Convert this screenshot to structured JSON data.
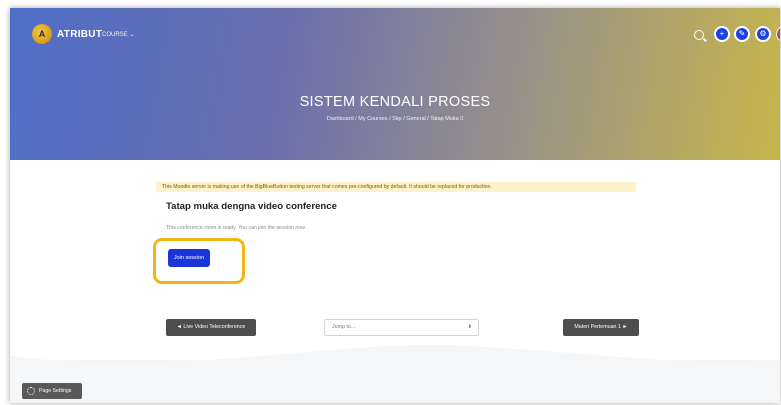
{
  "navbar": {
    "logo_text": "A",
    "brand": "ATRIBUT",
    "course_menu": "COURSE ⌄",
    "icons": [
      "search-icon",
      "add-icon",
      "edit-icon",
      "settings-icon",
      "avatar"
    ]
  },
  "header": {
    "title": "SISTEM KENDALI PROSES",
    "breadcrumb": "Dashboard / My Courses / Skp / General / Tatap Muka 0"
  },
  "main": {
    "warning": "This Moodle server is making use of the BigBlueButton testing server that comes pre-configured by default. It should be replaced for production.",
    "activity_title": "Tatap muka dengna video conference",
    "room_message": "This conference room is ready. You can join the session now.",
    "join_button": "Join session"
  },
  "navigation": {
    "prev_button": "◄ Live Video Teleconference",
    "jump_placeholder": "Jump to...",
    "jump_arrows": "⬍",
    "next_button": "Materi Pertemuan 1 ►"
  },
  "footer": {
    "settings_button": "Page Settings"
  },
  "colors": {
    "primary": "#1a35d8",
    "highlight": "#f1b515",
    "warning_bg": "#fcf1c9"
  }
}
